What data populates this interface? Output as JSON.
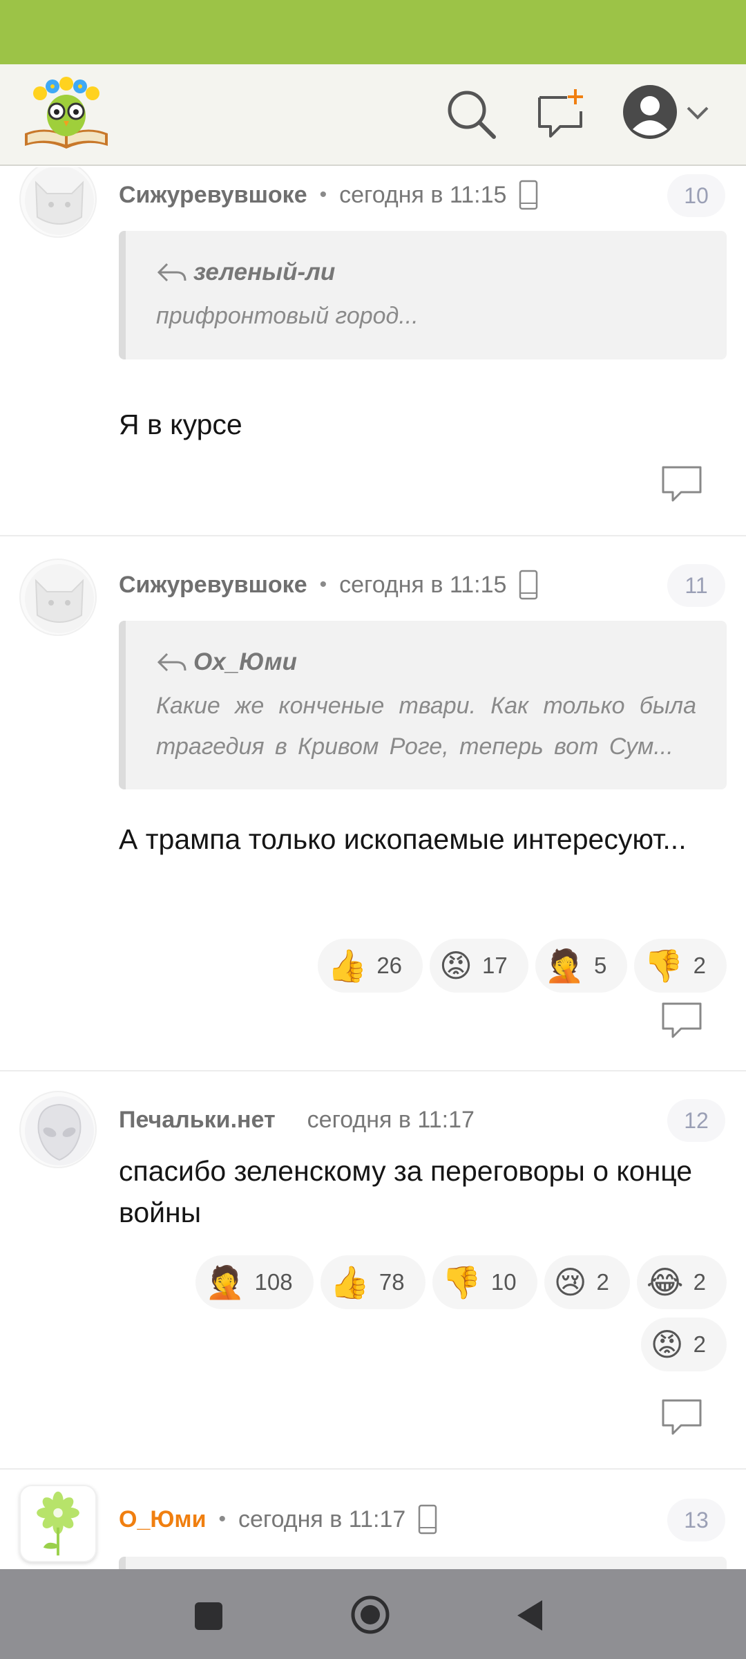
{
  "header": {
    "logo": "owl-book-logo",
    "icons": [
      "search-icon",
      "new-chat-icon",
      "user-avatar-icon",
      "chevron-down-icon"
    ]
  },
  "comments": [
    {
      "author": "Сижуревувшоке",
      "time": "сегодня в 11:15",
      "number": "10",
      "quote_author": "зеленый-ли",
      "quote_text": "прифронтовый город...",
      "body": "Я в курсе"
    },
    {
      "author": "Сижуревувшоке",
      "time": "сегодня в 11:15",
      "number": "11",
      "quote_author": "Ох_Юми",
      "quote_text": "Какие же конченые твари. Как только была трагедия в Кривом Роге, теперь вот Сум...",
      "body": "А трампа только ископаемые интересуют...",
      "reactions": [
        {
          "emoji": "👍",
          "count": "26"
        },
        {
          "emoji": "😡",
          "count": "17"
        },
        {
          "emoji": "🤦",
          "count": "5"
        },
        {
          "emoji": "👎",
          "count": "2"
        }
      ]
    },
    {
      "author": "Печальки.нет",
      "time": "сегодня в 11:17",
      "number": "12",
      "body": "спасибо зеленскому за переговоры о конце войны",
      "reactions": [
        {
          "emoji": "🤦",
          "count": "108"
        },
        {
          "emoji": "👍",
          "count": "78"
        },
        {
          "emoji": "👎",
          "count": "10"
        },
        {
          "emoji": "😢",
          "count": "2"
        },
        {
          "emoji": "😂",
          "count": "2"
        },
        {
          "emoji": "😡",
          "count": "2"
        }
      ]
    },
    {
      "author": "О_Юми",
      "time": "сегодня в 11:17",
      "number": "13",
      "author_color": "#f07f10"
    }
  ],
  "colors": {
    "status_bar": "#9cc347",
    "header_bg": "#f4f4ef",
    "nav_bar": "#8f8f93"
  }
}
